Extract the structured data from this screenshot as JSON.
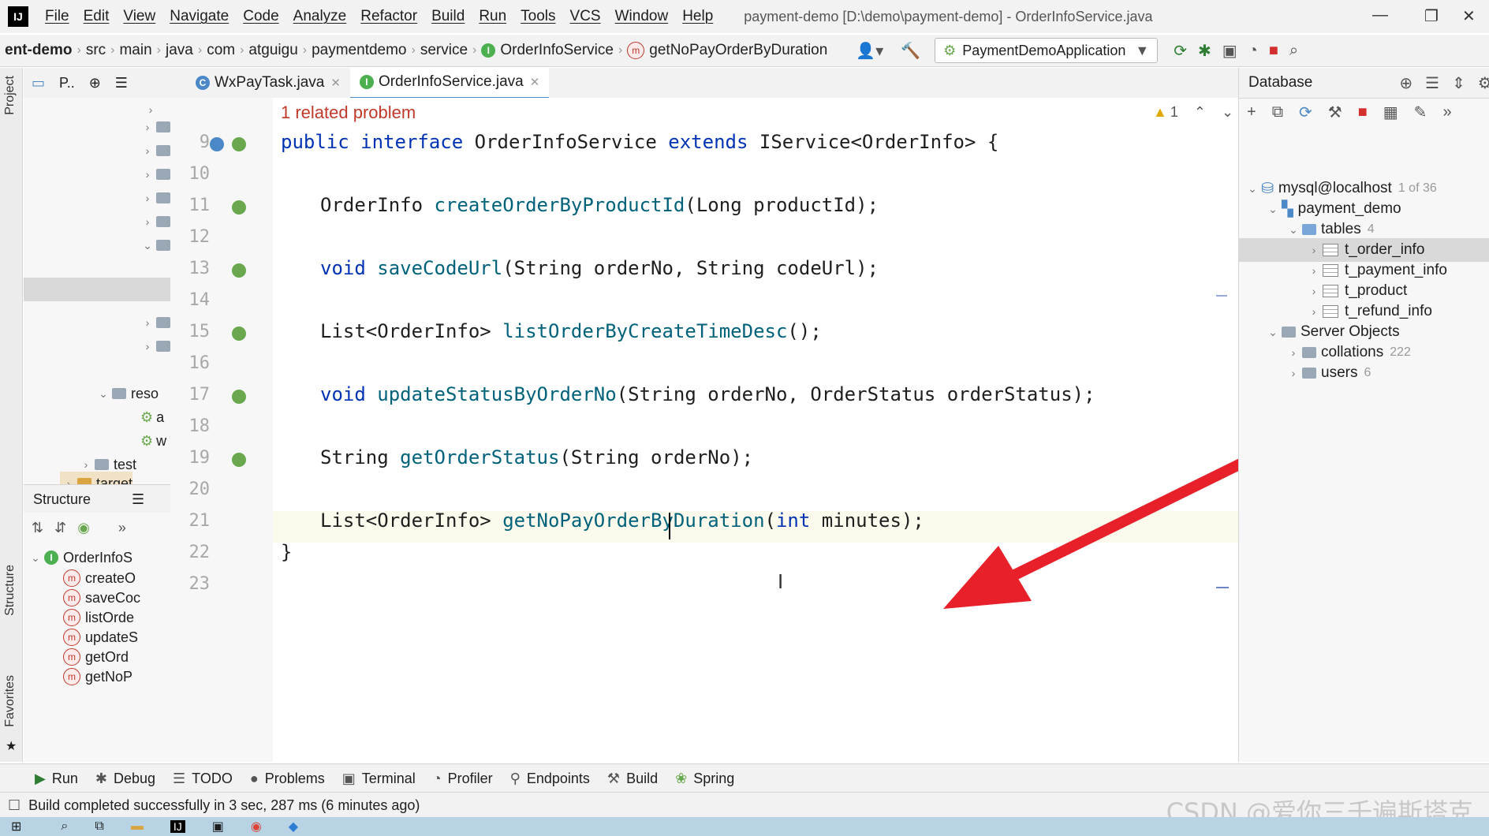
{
  "app": {
    "logo_text": "IJ",
    "menu": [
      "File",
      "Edit",
      "View",
      "Navigate",
      "Code",
      "Analyze",
      "Refactor",
      "Build",
      "Run",
      "Tools",
      "VCS",
      "Window",
      "Help"
    ],
    "window_title": "payment-demo [D:\\demo\\payment-demo] - OrderInfoService.java"
  },
  "breadcrumbs": [
    "ent-demo",
    "src",
    "main",
    "java",
    "com",
    "atguigu",
    "paymentdemo",
    "service",
    "OrderInfoService",
    "getNoPayOrderByDuration"
  ],
  "run_config": "PaymentDemoApplication",
  "tabs": [
    {
      "label": "WxPayTask.java",
      "active": false
    },
    {
      "label": "OrderInfoService.java",
      "active": true
    }
  ],
  "project_panel": {
    "header": "P..",
    "items": [
      "reso",
      "a",
      "w",
      "test",
      "target"
    ]
  },
  "side_labels": {
    "project": "Project",
    "structure": "Structure",
    "favorites": "Favorites"
  },
  "structure": {
    "title": "Structure",
    "root": "OrderInfoS",
    "members": [
      "createO",
      "saveCoc",
      "listOrde",
      "updateS",
      "getOrd",
      "getNoP"
    ]
  },
  "editor": {
    "problem_banner": "1 related problem",
    "warning_count": "1",
    "line_numbers": [
      "9",
      "10",
      "11",
      "12",
      "13",
      "14",
      "15",
      "16",
      "17",
      "18",
      "19",
      "20",
      "21",
      "22",
      "23"
    ],
    "code": {
      "l9_kw": "public interface",
      "l9_rest": " OrderInfoService ",
      "l9_kw2": "extends",
      "l9_tail": " IService<OrderInfo> {",
      "l11_type": "OrderInfo ",
      "l11_fn": "createOrderByProductId",
      "l11_args": "(Long productId);",
      "l13_kw": "void ",
      "l13_fn": "saveCodeUrl",
      "l13_args": "(String orderNo, String codeUrl);",
      "l15_type": "List<OrderInfo> ",
      "l15_fn": "listOrderByCreateTimeDesc",
      "l15_args": "();",
      "l17_kw": "void ",
      "l17_fn": "updateStatusByOrderNo",
      "l17_args": "(String orderNo, OrderStatus orderStatus);",
      "l19_type": "String ",
      "l19_fn": "getOrderStatus",
      "l19_args": "(String orderNo);",
      "l21_type": "List<OrderInfo> ",
      "l21_fn": "getNoPayOrderByDuration",
      "l21_open": "(",
      "l21_kw": "int",
      "l21_args": " minutes);",
      "l22": "}"
    }
  },
  "database": {
    "title": "Database",
    "connection": "mysql@localhost",
    "connection_count": "1 of 36",
    "schema": "payment_demo",
    "tables_label": "tables",
    "tables_count": "4",
    "tables": [
      "t_order_info",
      "t_payment_info",
      "t_product",
      "t_refund_info"
    ],
    "server_objects": "Server Objects",
    "collations": "collations",
    "collations_count": "222",
    "users": "users",
    "users_count": "6"
  },
  "bottom_tools": [
    "Run",
    "Debug",
    "TODO",
    "Problems",
    "Terminal",
    "Profiler",
    "Endpoints",
    "Build",
    "Spring"
  ],
  "status": "Build completed successfully in 3 sec, 287 ms (6 minutes ago)",
  "watermark": "CSDN @爱你三千遍斯塔克",
  "colors": {
    "keyword": "#0033b3",
    "function": "#00627a",
    "arrow": "#e8202a",
    "accent": "#4a88c7"
  }
}
